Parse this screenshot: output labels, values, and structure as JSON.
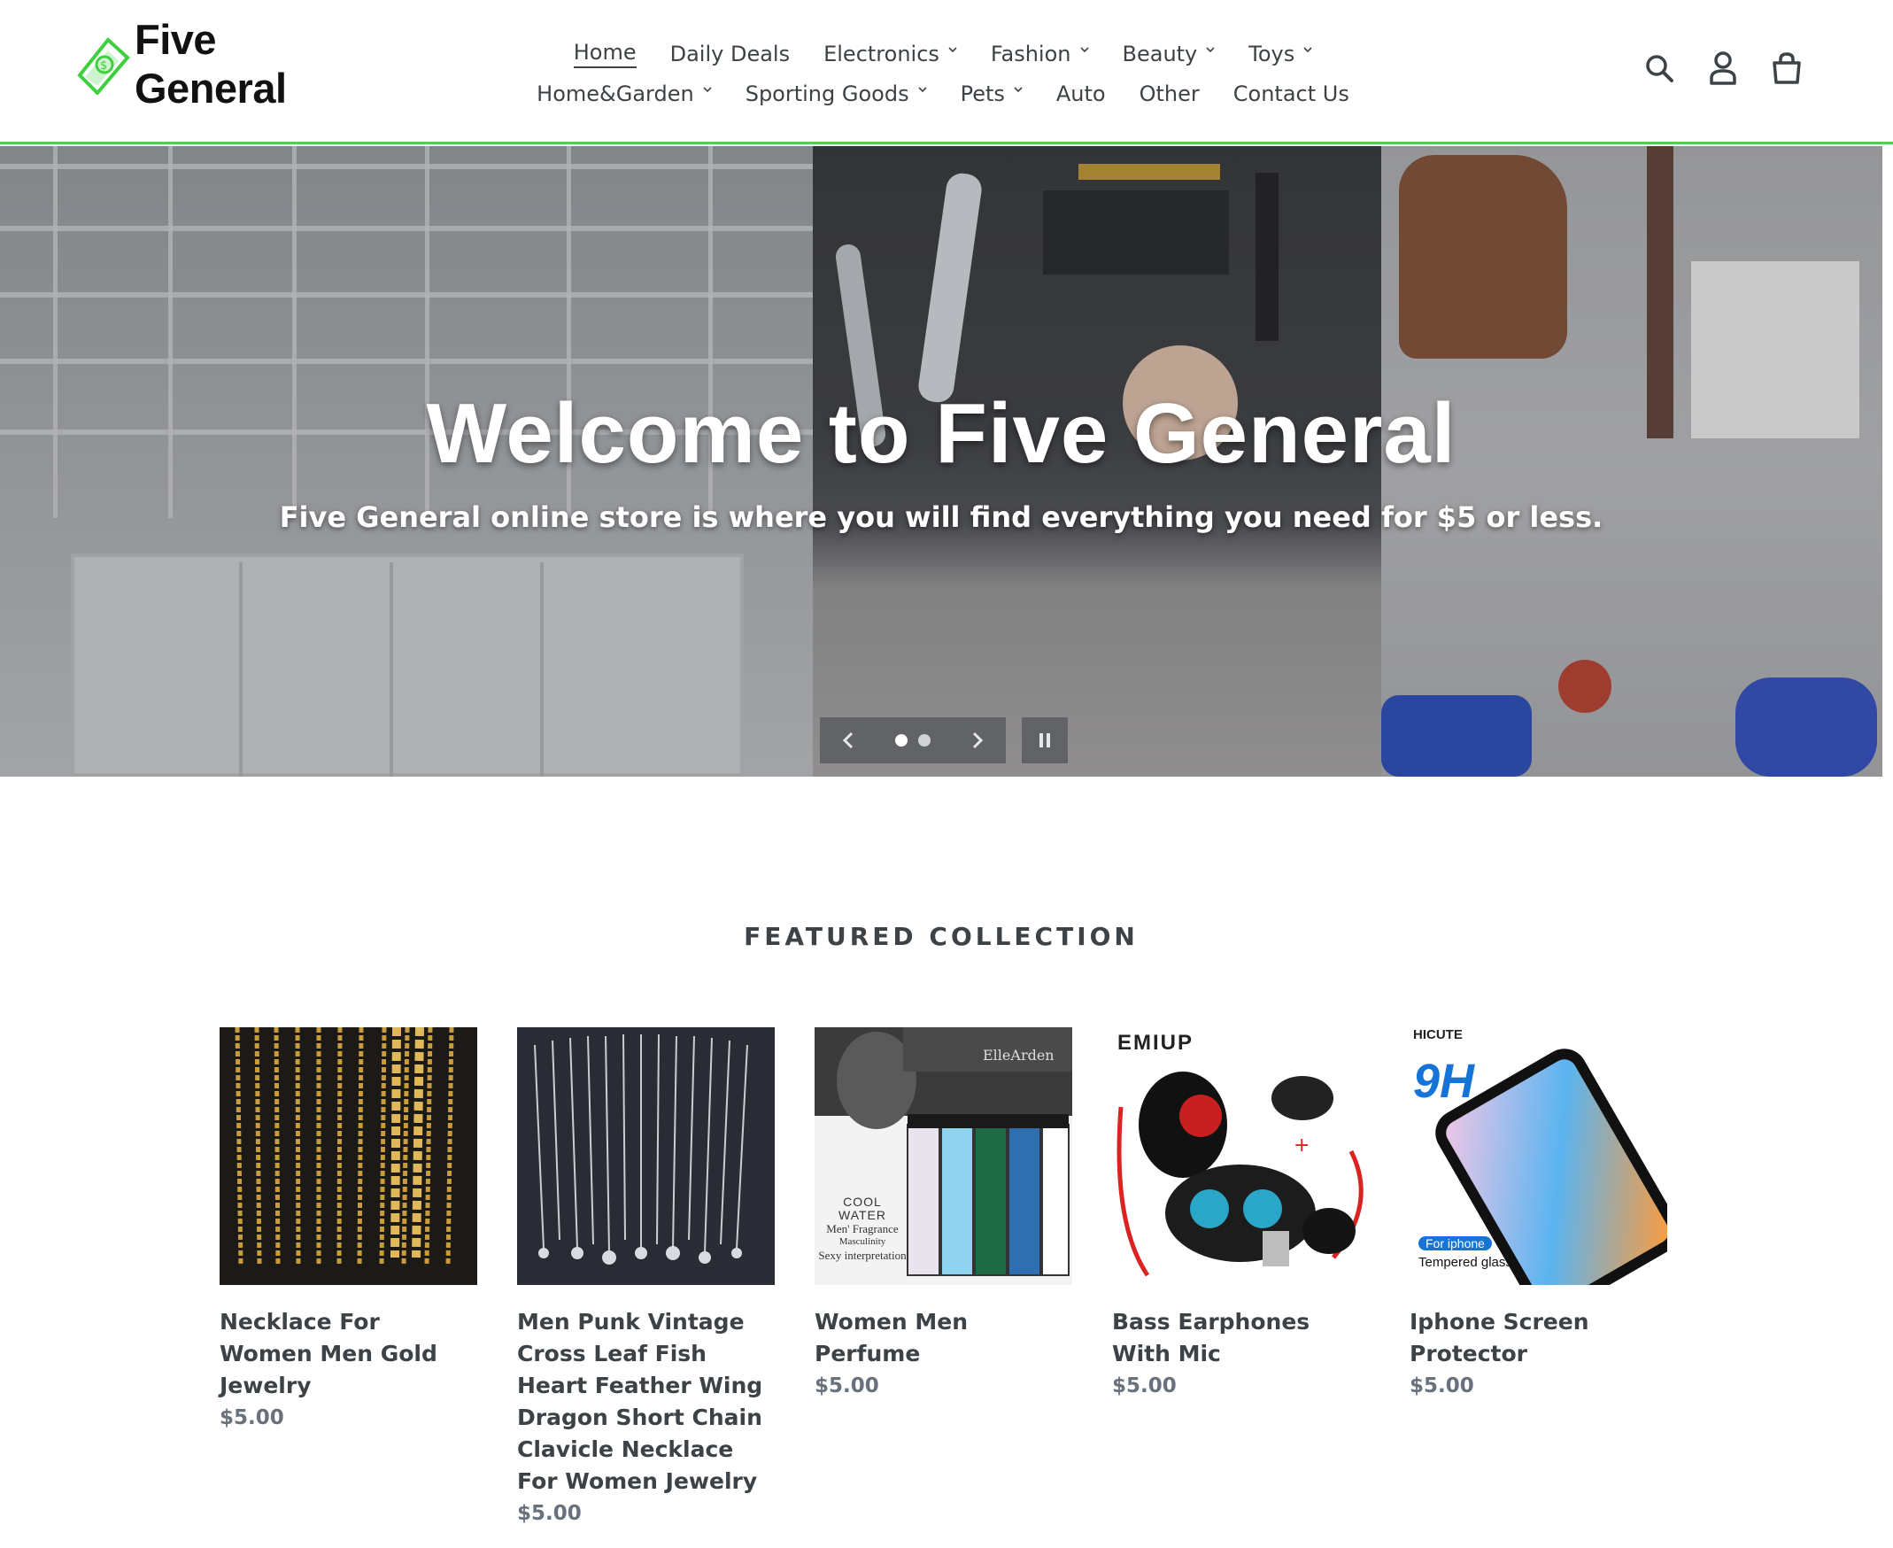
{
  "header": {
    "logo_text": "Five General",
    "nav_row1": [
      {
        "label": "Home",
        "dropdown": false,
        "active": true
      },
      {
        "label": "Daily Deals",
        "dropdown": false,
        "active": false
      },
      {
        "label": "Electronics",
        "dropdown": true,
        "active": false
      },
      {
        "label": "Fashion",
        "dropdown": true,
        "active": false
      },
      {
        "label": "Beauty",
        "dropdown": true,
        "active": false
      },
      {
        "label": "Toys",
        "dropdown": true,
        "active": false
      }
    ],
    "nav_row2": [
      {
        "label": "Home&Garden",
        "dropdown": true,
        "active": false
      },
      {
        "label": "Sporting Goods",
        "dropdown": true,
        "active": false
      },
      {
        "label": "Pets",
        "dropdown": true,
        "active": false
      },
      {
        "label": "Auto",
        "dropdown": false,
        "active": false
      },
      {
        "label": "Other",
        "dropdown": false,
        "active": false
      },
      {
        "label": "Contact Us",
        "dropdown": false,
        "active": false
      }
    ],
    "icons": [
      "search-icon",
      "account-icon",
      "cart-icon"
    ],
    "accent_color": "#4fcf4f"
  },
  "hero": {
    "title": "Welcome to Five General",
    "subtitle": "Five General online store is where you will find everything you need for $5 or less.",
    "slides_total": 2,
    "current_slide": 1
  },
  "featured": {
    "heading": "FEATURED COLLECTION",
    "products": [
      {
        "title": "Necklace For Women Men Gold Jewelry",
        "price": "$5.00",
        "image": "gold-chains"
      },
      {
        "title": "Men Punk Vintage Cross Leaf Fish Heart Feather Wing Dragon Short Chain Clavicle Necklace For Women Jewelry",
        "price": "$5.00",
        "image": "silver-pendants"
      },
      {
        "title": "Women Men Perfume",
        "price": "$5.00",
        "image": "perfume-vials"
      },
      {
        "title": "Bass Earphones With Mic",
        "price": "$5.00",
        "image": "earphones"
      },
      {
        "title": "Iphone Screen Protector",
        "price": "$5.00",
        "image": "screen-protector"
      }
    ],
    "image_text": {
      "perfume_brand": "ElleArden",
      "perfume_line1": "COOL WATER",
      "perfume_line2": "Men' Fragrance",
      "perfume_line3": "Masculinity",
      "perfume_line4": "Sexy interpretation",
      "earphone_brand": "EMIUP",
      "protector_brand": "HICUTE",
      "protector_badge": "9H",
      "protector_pill": "For iphone",
      "protector_caption": "Tempered glass"
    }
  }
}
